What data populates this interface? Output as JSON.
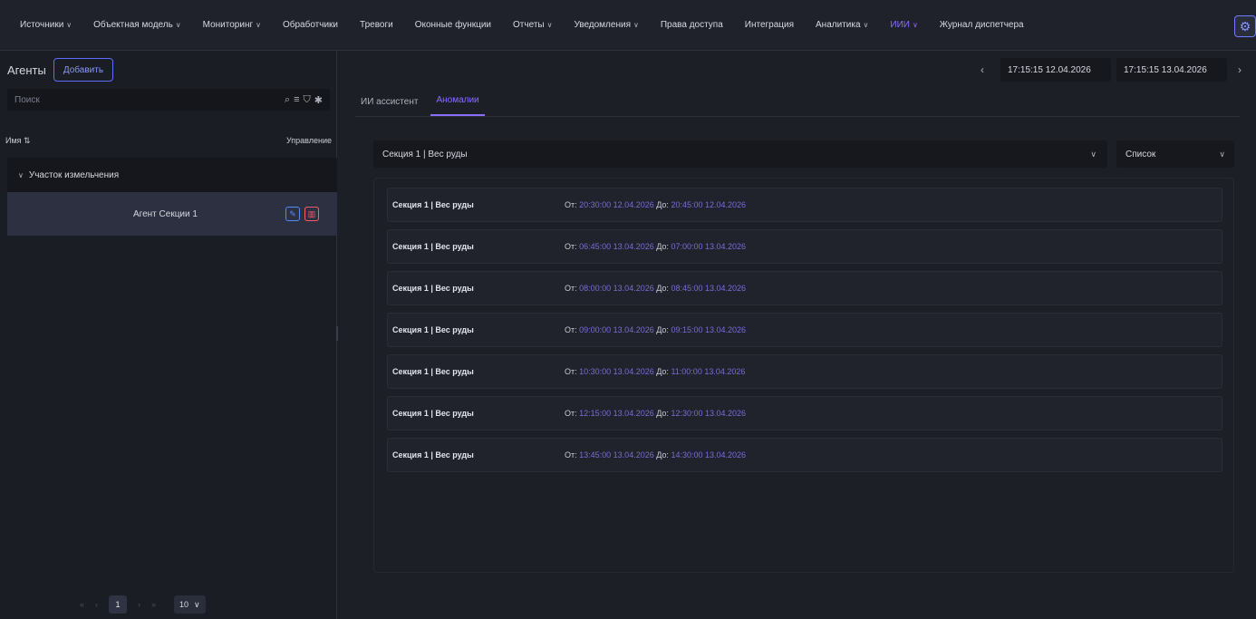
{
  "nav": {
    "items": [
      {
        "label": "Источники",
        "dropdown": true
      },
      {
        "label": "Объектная модель",
        "dropdown": true
      },
      {
        "label": "Мониторинг",
        "dropdown": true
      },
      {
        "label": "Обработчики",
        "dropdown": false
      },
      {
        "label": "Тревоги",
        "dropdown": false
      },
      {
        "label": "Оконные функции",
        "dropdown": false
      },
      {
        "label": "Отчеты",
        "dropdown": true
      },
      {
        "label": "Уведомления",
        "dropdown": true
      },
      {
        "label": "Права доступа",
        "dropdown": false
      },
      {
        "label": "Интеграция",
        "dropdown": false
      },
      {
        "label": "Аналитика",
        "dropdown": true
      },
      {
        "label": "ИИИ",
        "dropdown": true,
        "active": true
      },
      {
        "label": "Журнал диспетчера",
        "dropdown": false
      }
    ],
    "settings_icon": "gear-icon"
  },
  "sidebar": {
    "title": "Агенты",
    "add_label": "Добавить",
    "search_placeholder": "Поиск",
    "col_name": "Имя",
    "col_control": "Управление",
    "group_label": "Участок измельчения",
    "agent_name": "Агент Секции 1",
    "pagination": {
      "current": "1",
      "per_page": "10"
    }
  },
  "main": {
    "date_from": "17:15:15 12.04.2026",
    "date_to": "17:15:15 13.04.2026",
    "tabs": [
      {
        "label": "ИИ ассистент",
        "active": false
      },
      {
        "label": "Аномалии",
        "active": true
      }
    ],
    "selector": "Секция 1 | Вес руды",
    "view_mode": "Список",
    "from_label": "От:",
    "to_label": "До:",
    "anomalies": [
      {
        "name": "Секция 1 | Вес руды",
        "from": "20:30:00 12.04.2026",
        "to": "20:45:00 12.04.2026"
      },
      {
        "name": "Секция 1 | Вес руды",
        "from": "06:45:00 13.04.2026",
        "to": "07:00:00 13.04.2026"
      },
      {
        "name": "Секция 1 | Вес руды",
        "from": "08:00:00 13.04.2026",
        "to": "08:45:00 13.04.2026"
      },
      {
        "name": "Секция 1 | Вес руды",
        "from": "09:00:00 13.04.2026",
        "to": "09:15:00 13.04.2026"
      },
      {
        "name": "Секция 1 | Вес руды",
        "from": "10:30:00 13.04.2026",
        "to": "11:00:00 13.04.2026"
      },
      {
        "name": "Секция 1 | Вес руды",
        "from": "12:15:00 13.04.2026",
        "to": "12:30:00 13.04.2026"
      },
      {
        "name": "Секция 1 | Вес руды",
        "from": "13:45:00 13.04.2026",
        "to": "14:30:00 13.04.2026"
      }
    ]
  },
  "colors": {
    "accent": "#8a6cff",
    "selected_row": "#2d3040",
    "edit": "#4e8cff",
    "delete": "#ff5a6a"
  }
}
